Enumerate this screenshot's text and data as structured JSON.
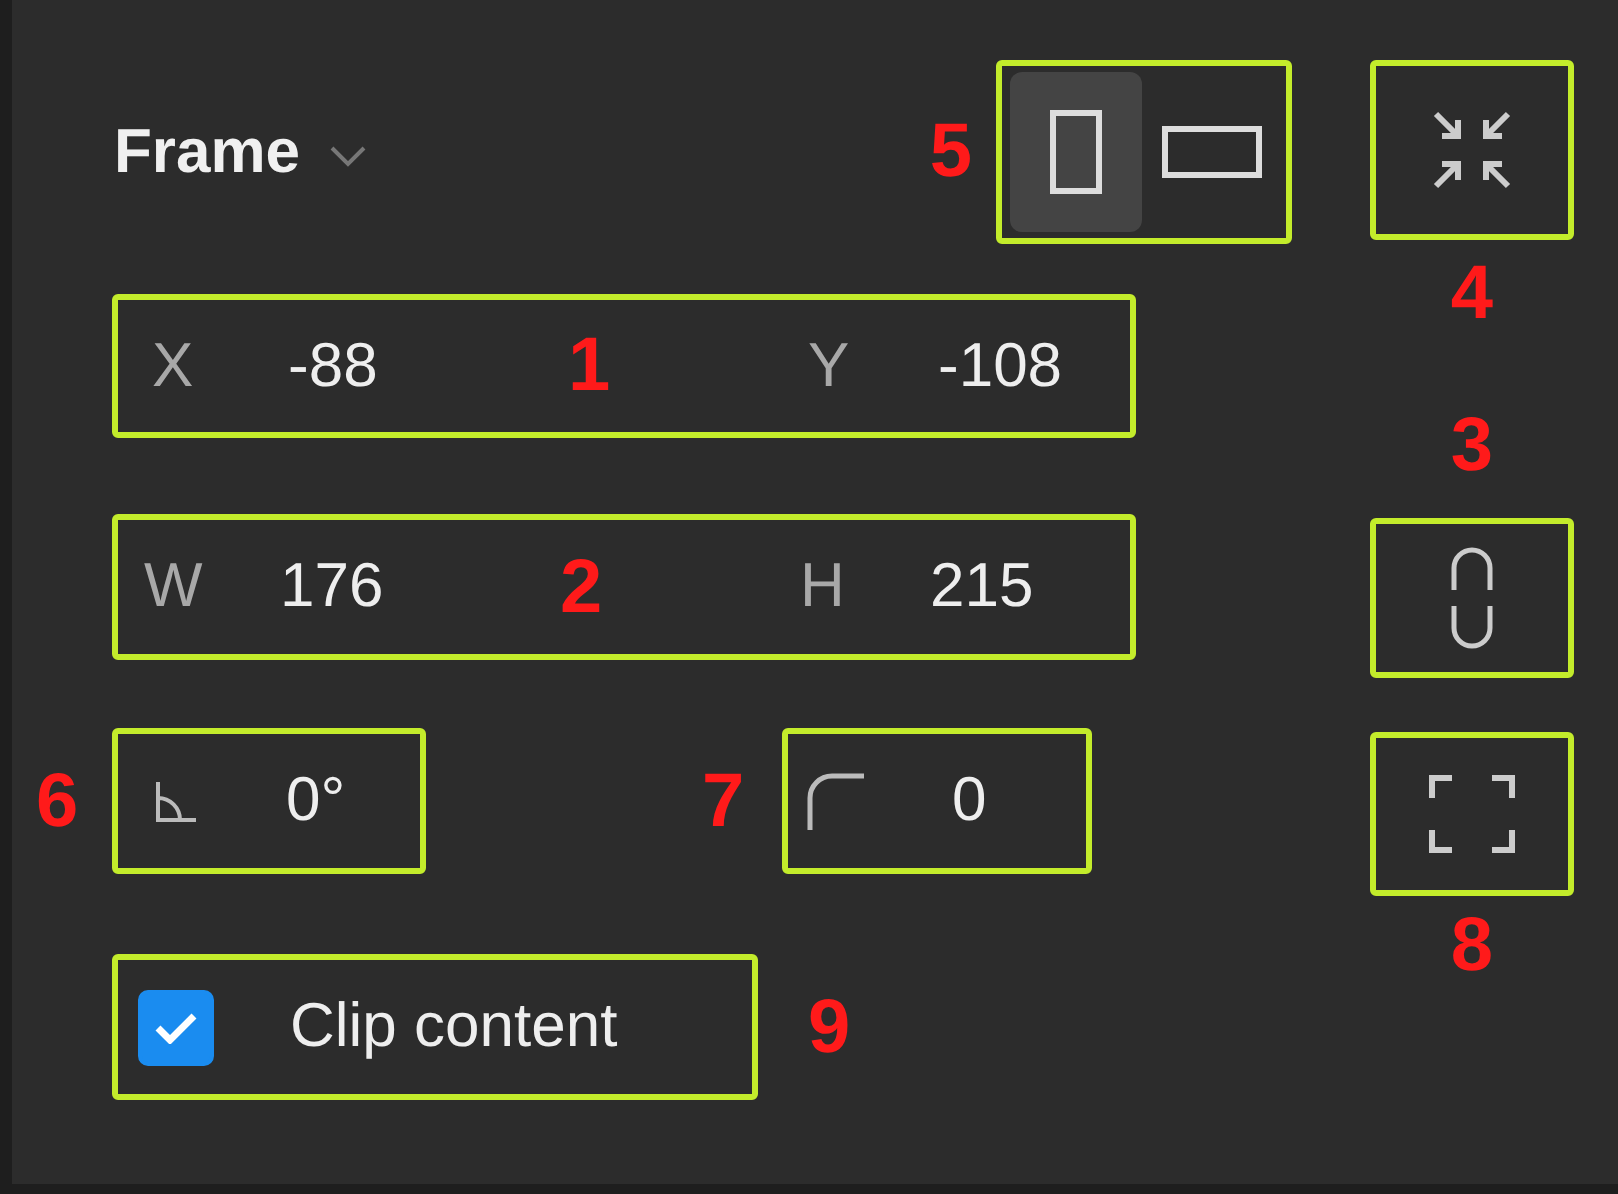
{
  "header": {
    "title": "Frame",
    "callout": "5",
    "orientation": [
      {
        "kind": "portrait",
        "selected": true
      },
      {
        "kind": "landscape",
        "selected": false
      }
    ]
  },
  "resize_to_fit": {
    "callout": "4"
  },
  "position": {
    "callout": "1",
    "fields": [
      {
        "label": "X",
        "value": "-88"
      },
      {
        "label": "Y",
        "value": "-108"
      }
    ]
  },
  "constrain_proportions": {
    "callout": "3"
  },
  "size": {
    "callout": "2",
    "fields": [
      {
        "label": "W",
        "value": "176"
      },
      {
        "label": "H",
        "value": "215"
      }
    ]
  },
  "rotation": {
    "callout": "6",
    "value": "0°"
  },
  "corner_radius": {
    "callout": "7",
    "value": "0"
  },
  "independent_corners": {
    "callout": "8"
  },
  "clip_content": {
    "callout": "9",
    "label": "Clip content",
    "checked": true
  }
}
